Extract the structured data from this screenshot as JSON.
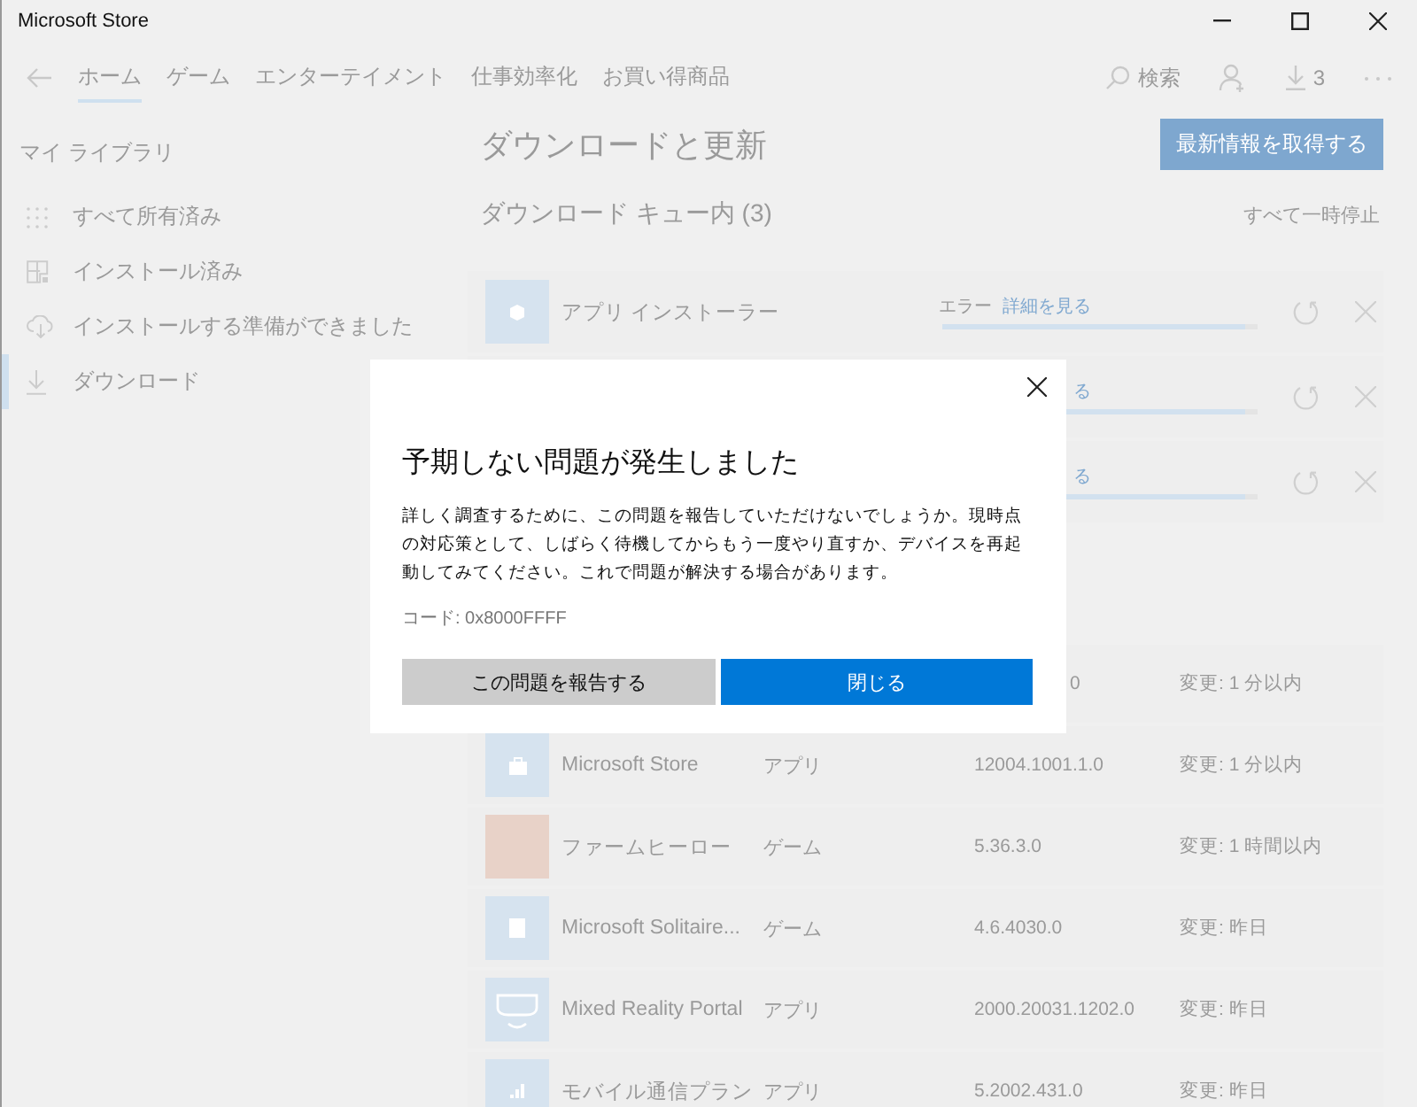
{
  "window": {
    "title": "Microsoft Store"
  },
  "nav": {
    "tabs": [
      {
        "label": "ホーム",
        "selected": true
      },
      {
        "label": "ゲーム",
        "selected": false
      },
      {
        "label": "エンターテイメント",
        "selected": false
      },
      {
        "label": "仕事効率化",
        "selected": false
      },
      {
        "label": "お買い得商品",
        "selected": false
      }
    ],
    "search_label": "検索",
    "downloads_count": "3"
  },
  "sidebar": {
    "heading": "マイ ライブラリ",
    "items": [
      {
        "label": "すべて所有済み",
        "kind": "grid",
        "selected": false
      },
      {
        "label": "インストール済み",
        "kind": "installed",
        "selected": false
      },
      {
        "label": "インストールする準備ができました",
        "kind": "cloud",
        "selected": false
      },
      {
        "label": "ダウンロード",
        "kind": "download",
        "selected": true
      }
    ]
  },
  "main": {
    "title": "ダウンロードと更新",
    "update_button": "最新情報を取得する",
    "queue_heading": "ダウンロード キュー内 (3)",
    "pause_all": "すべて一時停止",
    "queue": [
      {
        "name": "アプリ インストーラー",
        "kind": "box",
        "status": "エラー",
        "link": "詳細を見る",
        "level": 0.96
      },
      {
        "link": "る",
        "level": 0.96
      },
      {
        "link": "る",
        "level": 0.96
      }
    ],
    "updates": [
      {
        "version": "0",
        "changed": "変更: 1 分以内"
      },
      {
        "name": "Microsoft Store",
        "kind": "bag",
        "type": "アプリ",
        "version": "12004.1001.1.0",
        "changed": "変更: 1 分以内"
      },
      {
        "name": "ファームヒーロー",
        "kind": "art",
        "type": "ゲーム",
        "version": "5.36.3.0",
        "changed": "変更: 1 時間以内"
      },
      {
        "name": "Microsoft Solitaire...",
        "kind": "cards",
        "type": "ゲーム",
        "version": "4.6.4030.0",
        "changed": "変更: 昨日"
      },
      {
        "name": "Mixed Reality Portal",
        "kind": "headset",
        "type": "アプリ",
        "version": "2000.20031.1202.0",
        "changed": "変更: 昨日"
      },
      {
        "name": "モバイル通信プラン",
        "kind": "signal",
        "type": "アプリ",
        "version": "5.2002.431.0",
        "changed": "変更: 昨日"
      }
    ]
  },
  "dialog": {
    "title": "予期しない問題が発生しました",
    "body": "詳しく調査するために、この問題を報告していただけないでしょうか。現時点の対応策として、しばらく待機してからもう一度やり直すか、デバイスを再起動してみてください。これで問題が解決する場合があります。",
    "code": "コード: 0x8000FFFF",
    "report_button": "この問題を報告する",
    "close_button": "閉じる"
  }
}
